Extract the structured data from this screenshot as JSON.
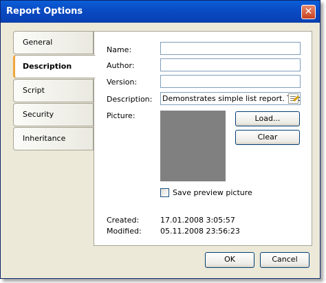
{
  "window": {
    "title": "Report Options",
    "close_glyph": "✕"
  },
  "tabs": [
    {
      "label": "General",
      "active": false
    },
    {
      "label": "Description",
      "active": true
    },
    {
      "label": "Script",
      "active": false
    },
    {
      "label": "Security",
      "active": false
    },
    {
      "label": "Inheritance",
      "active": false
    }
  ],
  "form": {
    "name_label": "Name:",
    "name_value": "",
    "author_label": "Author:",
    "author_value": "",
    "version_label": "Version:",
    "version_value": "",
    "description_label": "Description:",
    "description_value": "Demonstrates simple list report. To cr",
    "picture_label": "Picture:",
    "load_button": "Load...",
    "clear_button": "Clear",
    "save_preview_label": "Save preview picture",
    "save_preview_checked": false,
    "created_label": "Created:",
    "created_value": "17.01.2008 3:05:57",
    "modified_label": "Modified:",
    "modified_value": "05.11.2008 23:56:23"
  },
  "footer": {
    "ok_button": "OK",
    "cancel_button": "Cancel"
  },
  "colors": {
    "titlebar": "#0a4bc4",
    "dialog_bg": "#ece9d8",
    "active_tab_accent": "#f0a43a",
    "picture_placeholder": "#808080"
  },
  "icons": {
    "close": "close-icon",
    "description_edit": "edit-icon"
  }
}
